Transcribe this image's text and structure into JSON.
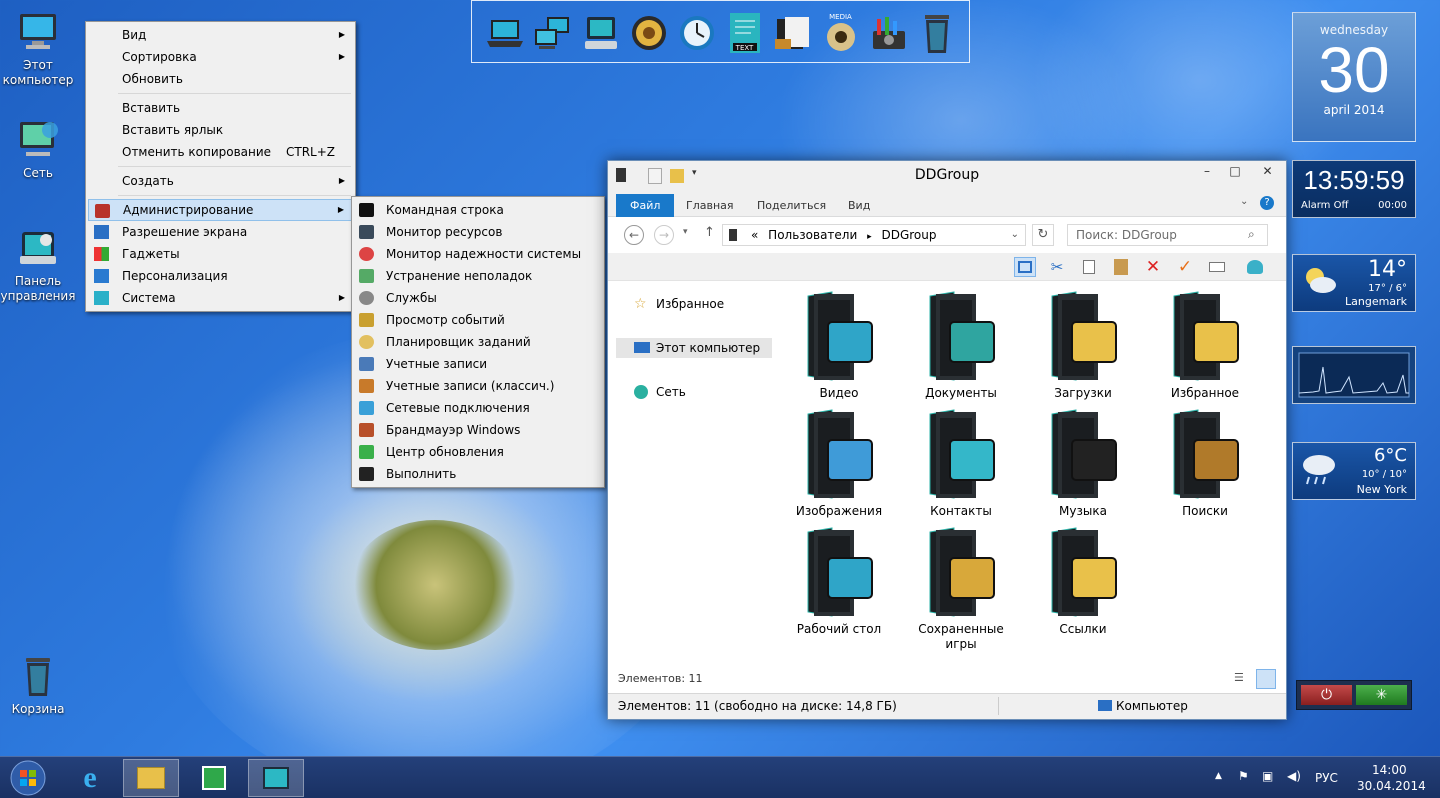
{
  "desktop_icons": [
    {
      "label": "Этот\nкомпьютер",
      "icon": "computer-icon"
    },
    {
      "label": "Сеть",
      "icon": "network-icon"
    },
    {
      "label": "Панель\nуправления",
      "icon": "control-panel-icon"
    },
    {
      "label": "Корзина",
      "icon": "recycle-bin-icon"
    }
  ],
  "context_menu": {
    "view": "Вид",
    "sort": "Сортировка",
    "refresh": "Обновить",
    "paste": "Вставить",
    "paste_shortcut": "Вставить ярлык",
    "undo_copy": "Отменить копирование",
    "undo_copy_key": "CTRL+Z",
    "create": "Создать",
    "admin": "Администрирование",
    "screen_res": "Разрешение экрана",
    "gadgets": "Гаджеты",
    "personalize": "Персонализация",
    "system": "Система"
  },
  "admin_submenu": [
    "Командная строка",
    "Монитор ресурсов",
    "Монитор надежности системы",
    "Устранение неполадок",
    "Службы",
    "Просмотр событий",
    "Планировщик заданий",
    "Учетные записи",
    "Учетные записи (классич.)",
    "Сетевые подключения",
    "Брандмауэр Windows",
    "Центр обновления",
    "Выполнить"
  ],
  "dock": {
    "icons": [
      "laptop-icon",
      "network-computers-icon",
      "control-panel-icon",
      "media-icon",
      "clock-icon",
      "text-editor-icon",
      "media-player-icon",
      "media-center-icon",
      "tools-icon",
      "recycle-bin-icon"
    ],
    "text_label": "TEXT",
    "media_label": "MEDIA"
  },
  "explorer": {
    "title": "DDGroup",
    "tabs": {
      "file": "Файл",
      "home": "Главная",
      "share": "Поделиться",
      "view": "Вид"
    },
    "address": {
      "prefix": "«",
      "crumb1": "Пользователи",
      "crumb2": "DDGroup"
    },
    "search_placeholder": "Поиск: DDGroup",
    "nav": {
      "favorites": "Избранное",
      "this_pc": "Этот компьютер",
      "network": "Сеть"
    },
    "folders": [
      {
        "name": "Видео",
        "accent": "#2fa5c8"
      },
      {
        "name": "Документы",
        "accent": "#2fa5a0"
      },
      {
        "name": "Загрузки",
        "accent": "#e9c14a"
      },
      {
        "name": "Избранное",
        "accent": "#e9c14a"
      },
      {
        "name": "Изображения",
        "accent": "#3f9bd8"
      },
      {
        "name": "Контакты",
        "accent": "#34b7c9"
      },
      {
        "name": "Музыка",
        "accent": "#222222"
      },
      {
        "name": "Поиски",
        "accent": "#b07a2a"
      },
      {
        "name": "Рабочий стол",
        "accent": "#2fa5c8"
      },
      {
        "name": "Сохраненные\nигры",
        "accent": "#d8a83a"
      },
      {
        "name": "Ссылки",
        "accent": "#e9c14a"
      }
    ],
    "items_count_label": "Элементов: 11",
    "status_left": "Элементов: 11 (свободно на диске: 14,8 ГБ)",
    "status_right": "Компьютер"
  },
  "gadgets": {
    "calendar": {
      "weekday": "wednesday",
      "day": "30",
      "month_year": "april 2014"
    },
    "clock": {
      "time": "13:59:59",
      "alarm_label": "Alarm Off",
      "alarm_time": "00:00"
    },
    "weather1": {
      "temp": "14°",
      "range": "17° / 6°",
      "city": "Langemark"
    },
    "weather2": {
      "temp": "6°C",
      "range": "10° / 10°",
      "city": "New York"
    }
  },
  "taskbar": {
    "language": "РУС",
    "time": "14:00",
    "date": "30.04.2014"
  }
}
